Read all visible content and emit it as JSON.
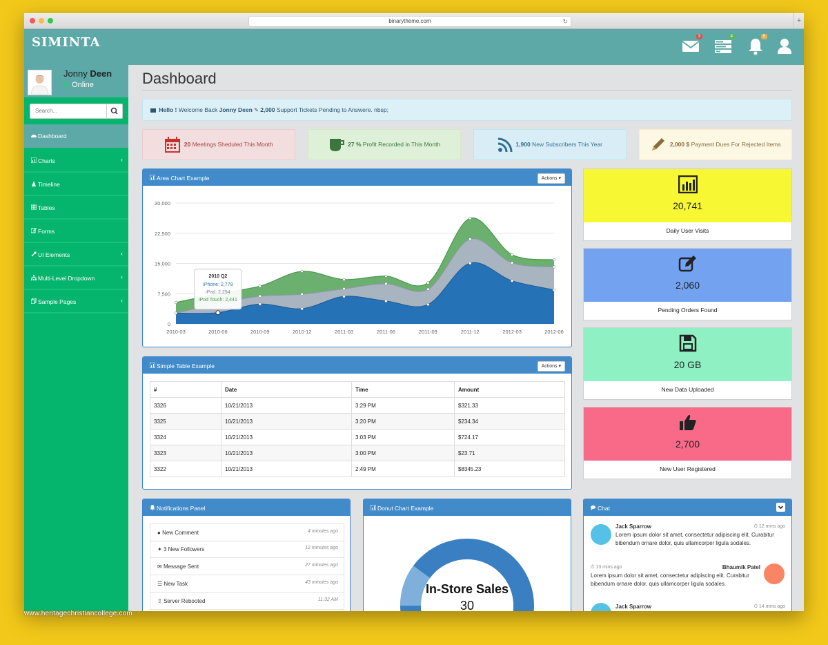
{
  "browser": {
    "url": "binarytheme.com"
  },
  "topnav": {
    "brand": "SIMINTA",
    "mail_count": "3",
    "tasks_count": "4",
    "alerts_count": "5"
  },
  "sidebar": {
    "user": {
      "first_name": "Jonny",
      "last_name": "Deen",
      "status": "Online"
    },
    "search_placeholder": "Search...",
    "items": [
      {
        "label": "Dashboard"
      },
      {
        "label": "Charts"
      },
      {
        "label": "Timeline"
      },
      {
        "label": "Tables"
      },
      {
        "label": "Forms"
      },
      {
        "label": "UI Elements"
      },
      {
        "label": "Multi-Level Dropdown"
      },
      {
        "label": "Sample Pages"
      }
    ]
  },
  "page": {
    "title": "Dashboard",
    "welcome": {
      "hello": "Hello !",
      "pre_name": " Welcome Back ",
      "name": "Jonny Deen",
      "count": " 2,000",
      "rest": " Support Tickets Pending to Answere. nbsp;"
    }
  },
  "stats": [
    {
      "value": "20",
      "text": " Meetings Sheduled This Month",
      "color": "#f2dede",
      "text_color": "#a94442"
    },
    {
      "value": "27 %",
      "text": " Profit Recorded in This Month",
      "color": "#dff0d8",
      "text_color": "#3c763d"
    },
    {
      "value": "1,900",
      "text": " New Subscribers This Year",
      "color": "#d9edf7",
      "text_color": "#31708f"
    },
    {
      "value": "2,000 $",
      "text": " Payment Dues For Rejected Items",
      "color": "#fcf8e3",
      "text_color": "#8a6d3b"
    }
  ],
  "area_panel": {
    "title": "Area Chart Example",
    "actions": "Actions ▾"
  },
  "chart_data": {
    "type": "area",
    "x": [
      "2010 Q1",
      "2010 Q2",
      "2010 Q3",
      "2010 Q4",
      "2011 Q1",
      "2011 Q2",
      "2011 Q3",
      "2011 Q4",
      "2012 Q1",
      "2012 Q2"
    ],
    "x_tick_labels": [
      "2010-03",
      "2010-06",
      "2010-09",
      "2010-12",
      "2011-03",
      "2011-06",
      "2011-09",
      "2011-12",
      "2012-03",
      "2012-06"
    ],
    "y_ticks": [
      "0",
      "7,500",
      "15,000",
      "22,500",
      "30,000"
    ],
    "ylim": [
      0,
      30000
    ],
    "stacked": true,
    "series": [
      {
        "name": "iPhone",
        "color": "#2672b7",
        "values": [
          2666,
          2778,
          4912,
          3767,
          6810,
          5670,
          4820,
          15073,
          10687,
          8432
        ]
      },
      {
        "name": "iPad",
        "color": "#a8b4c0",
        "values": [
          0,
          2294,
          1969,
          3597,
          1914,
          4293,
          3795,
          5967,
          4460,
          5713
        ]
      },
      {
        "name": "iPod Touch",
        "color": "#6bb06e",
        "values": [
          2647,
          2441,
          2501,
          5689,
          2293,
          1881,
          1588,
          5175,
          2028,
          1791
        ]
      }
    ],
    "tooltip": {
      "title": "2010 Q2",
      "lines": [
        "iPhone: 2,778",
        "iPad: 2,294",
        "iPod Touch: 2,441"
      ]
    },
    "grid": true
  },
  "table_panel": {
    "title": "Simple Table Example",
    "actions": "Actions ▾",
    "headers": [
      "#",
      "Date",
      "Time",
      "Amount"
    ],
    "rows": [
      [
        "3326",
        "10/21/2013",
        "3:29 PM",
        "$321.33"
      ],
      [
        "3325",
        "10/21/2013",
        "3:20 PM",
        "$234.34"
      ],
      [
        "3324",
        "10/21/2013",
        "3:03 PM",
        "$724.17"
      ],
      [
        "3323",
        "10/21/2013",
        "3:00 PM",
        "$23.71"
      ],
      [
        "3322",
        "10/21/2013",
        "2:49 PM",
        "$8345.23"
      ]
    ]
  },
  "tiles": [
    {
      "value": "20,741",
      "label": "Daily User Visits",
      "color": "#f7f733",
      "icon": "bar-chart-icon"
    },
    {
      "value": "2,060",
      "label": "Pending Orders Found",
      "color": "#72a2f0",
      "icon": "edit-icon"
    },
    {
      "value": "20 GB",
      "label": "New Data Uploaded",
      "color": "#8ef0c3",
      "icon": "floppy-disk-icon"
    },
    {
      "value": "2,700",
      "label": "New User Registered",
      "color": "#f86a88",
      "icon": "thumbs-up-icon"
    }
  ],
  "notifications": {
    "title": "Notifications Panel",
    "items": [
      {
        "label": "New Comment",
        "time": "4 minutes ago",
        "icon": "comment-icon"
      },
      {
        "label": "3 New Followers",
        "time": "12 minutes ago",
        "icon": "twitter-icon"
      },
      {
        "label": "Message Sent",
        "time": "27 minutes ago",
        "icon": "envelope-icon"
      },
      {
        "label": "New Task",
        "time": "43 minutes ago",
        "icon": "tasks-icon"
      },
      {
        "label": "Server Rebooted",
        "time": "11:32 AM",
        "icon": "upload-icon"
      }
    ]
  },
  "donut": {
    "title": "Donut Chart Example",
    "center_label": "In-Store Sales",
    "center_value": "30"
  },
  "chat": {
    "title": "Chat",
    "messages": [
      {
        "name": "Jack Sparrow",
        "time": "12 mins ago",
        "text": "Lorem ipsum dolor sit amet, consectetur adipiscing elit. Curabitur bibendum ornare dolor, quis ullamcorper ligula sodales.",
        "side": "left",
        "avatar_color": "#55c1e7"
      },
      {
        "name": "Bhaumik Patel",
        "time": "13 mins ago",
        "text": "Lorem ipsum dolor sit amet, consectetur adipiscing elit. Curabitur bibendum ornare dolor, quis ullamcorper ligula sodales.",
        "side": "right",
        "avatar_color": "#fa8564"
      },
      {
        "name": "Jack Sparrow",
        "time": "14 mins ago",
        "text": "",
        "side": "left",
        "avatar_color": "#55c1e7"
      }
    ]
  },
  "watermark": "www.heritagechristiancollege.com"
}
